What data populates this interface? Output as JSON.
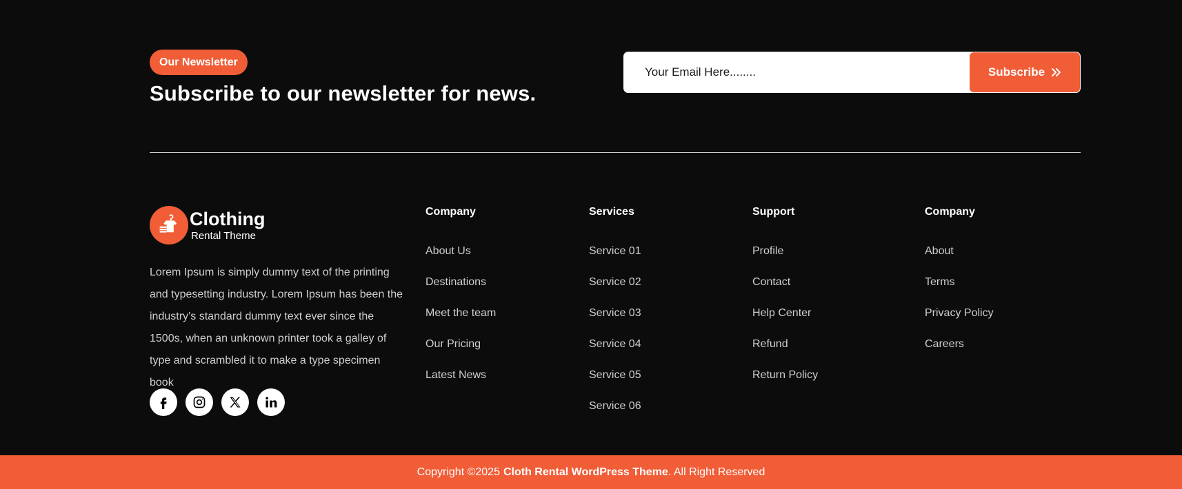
{
  "newsletter": {
    "badge": "Our Newsletter",
    "title": "Subscribe to our newsletter for news.",
    "email_placeholder": "Your Email Here........",
    "subscribe_label": "Subscribe"
  },
  "brand": {
    "name": "Clothing",
    "tagline": "Rental Theme",
    "description": "Lorem Ipsum is simply dummy text of the printing and typesetting industry. Lorem Ipsum has been the industry’s standard dummy text ever since the 1500s, when an unknown printer took a galley of type and scrambled it to make a type specimen book",
    "socials": [
      "facebook-icon",
      "instagram-icon",
      "x-icon",
      "linkedin-icon"
    ]
  },
  "columns": [
    {
      "title": "Company",
      "links": [
        "About Us",
        "Destinations",
        "Meet the team",
        "Our Pricing",
        "Latest News"
      ]
    },
    {
      "title": "Services",
      "links": [
        "Service 01",
        "Service 02",
        "Service 03",
        "Service 04",
        "Service 05",
        "Service 06"
      ]
    },
    {
      "title": "Support",
      "links": [
        "Profile",
        "Contact",
        "Help Center",
        "Refund",
        "Return Policy"
      ]
    },
    {
      "title": "Company",
      "links": [
        "About",
        "Terms",
        "Privacy Policy",
        "Careers"
      ]
    }
  ],
  "copyright": {
    "prefix": "Copyright ©2025",
    "brand": "Cloth Rental WordPress Theme",
    "suffix": ". All Right Reserved"
  },
  "colors": {
    "accent": "#f05d37",
    "background": "#0c0c0c",
    "text_muted": "#cfcfcf"
  }
}
